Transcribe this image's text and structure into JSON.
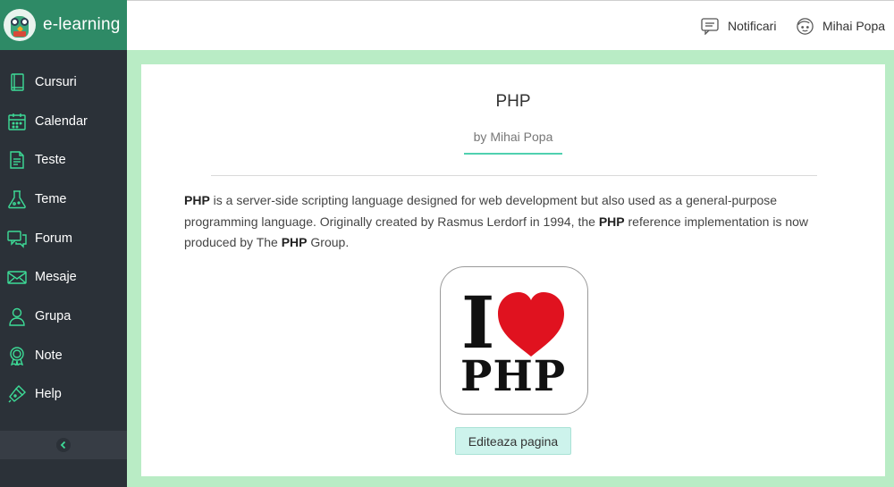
{
  "brand": {
    "title": "e-learning"
  },
  "sidebar": {
    "items": [
      {
        "label": "Cursuri",
        "icon": "book-icon"
      },
      {
        "label": "Calendar",
        "icon": "calendar-icon"
      },
      {
        "label": "Teste",
        "icon": "document-icon"
      },
      {
        "label": "Teme",
        "icon": "flask-icon"
      },
      {
        "label": "Forum",
        "icon": "chat-icon"
      },
      {
        "label": "Mesaje",
        "icon": "envelope-icon"
      },
      {
        "label": "Grupa",
        "icon": "person-icon"
      },
      {
        "label": "Note",
        "icon": "badge-icon"
      },
      {
        "label": "Help",
        "icon": "flashlight-icon"
      }
    ],
    "collapse_icon": "chevron-left-icon"
  },
  "topbar": {
    "notifications_label": "Notificari",
    "user_label": "Mihai Popa"
  },
  "course": {
    "title": "PHP",
    "author": "by Mihai Popa",
    "description": {
      "b1": "PHP",
      "t1": " is a server-side scripting language designed for web development but also used as a general-purpose programming language. Originally created by Rasmus Lerdorf in 1994, the ",
      "b2": "PHP",
      "t2": " reference implementation is now produced by The ",
      "b3": "PHP",
      "t3": " Group."
    },
    "image": {
      "line1": "I",
      "line2": "PHP"
    },
    "edit_button": "Editeaza pagina"
  },
  "colors": {
    "sidebar_bg": "#2b3138",
    "brand_bg": "#2e8a66",
    "accent": "#4fd1b0",
    "page_bg": "#b9ecc5",
    "heart": "#e0121f"
  }
}
